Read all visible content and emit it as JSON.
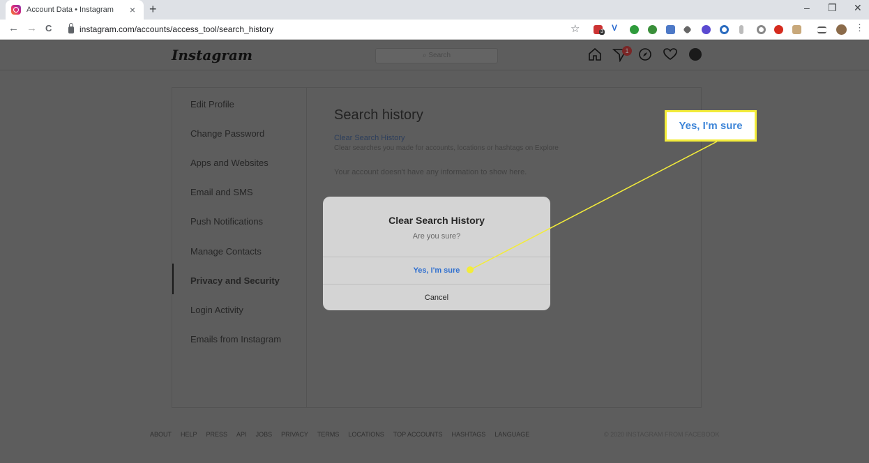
{
  "browser": {
    "tab_title": "Account Data • Instagram",
    "tab_close": "×",
    "new_tab": "+",
    "url": "instagram.com/accounts/access_tool/search_history",
    "window_controls": [
      "–",
      "❐",
      "✕"
    ],
    "nav": {
      "back": "←",
      "forward": "→",
      "reload": "C"
    },
    "extension_icons": [
      "pdf-icon",
      "v-icon",
      "evernote-icon",
      "grammarly-icon",
      "ext-blue-icon",
      "arrow-icon",
      "purple-icon",
      "circle-icon",
      "pin-icon",
      "grey-circle-icon",
      "adblock-icon",
      "cat-icon",
      "reading-list-icon",
      "profile-avatar"
    ],
    "extension_badge_text": "3"
  },
  "instagram": {
    "logo": "Instagram",
    "search_placeholder": "Search",
    "notification_count": "1",
    "header_icons": [
      "home-icon",
      "direct-icon",
      "explore-icon",
      "heart-icon",
      "profile-avatar"
    ],
    "sidebar": {
      "items": [
        {
          "label": "Edit Profile",
          "active": false
        },
        {
          "label": "Change Password",
          "active": false
        },
        {
          "label": "Apps and Websites",
          "active": false
        },
        {
          "label": "Email and SMS",
          "active": false
        },
        {
          "label": "Push Notifications",
          "active": false
        },
        {
          "label": "Manage Contacts",
          "active": false
        },
        {
          "label": "Privacy and Security",
          "active": true
        },
        {
          "label": "Login Activity",
          "active": false
        },
        {
          "label": "Emails from Instagram",
          "active": false
        }
      ]
    },
    "main": {
      "title": "Search history",
      "clear_link": "Clear Search History",
      "clear_desc": "Clear searches you made for accounts, locations or hashtags on Explore",
      "empty_text": "Your account doesn't have any information to show here."
    },
    "footer": {
      "links": [
        "ABOUT",
        "HELP",
        "PRESS",
        "API",
        "JOBS",
        "PRIVACY",
        "TERMS",
        "LOCATIONS",
        "TOP ACCOUNTS",
        "HASHTAGS",
        "LANGUAGE"
      ],
      "copyright": "© 2020 INSTAGRAM FROM FACEBOOK"
    }
  },
  "modal": {
    "title": "Clear Search History",
    "subtitle": "Are you sure?",
    "confirm": "Yes, I'm sure",
    "cancel": "Cancel"
  },
  "annotation": {
    "callout_text": "Yes, I'm sure",
    "color": "#f3ec3a"
  }
}
